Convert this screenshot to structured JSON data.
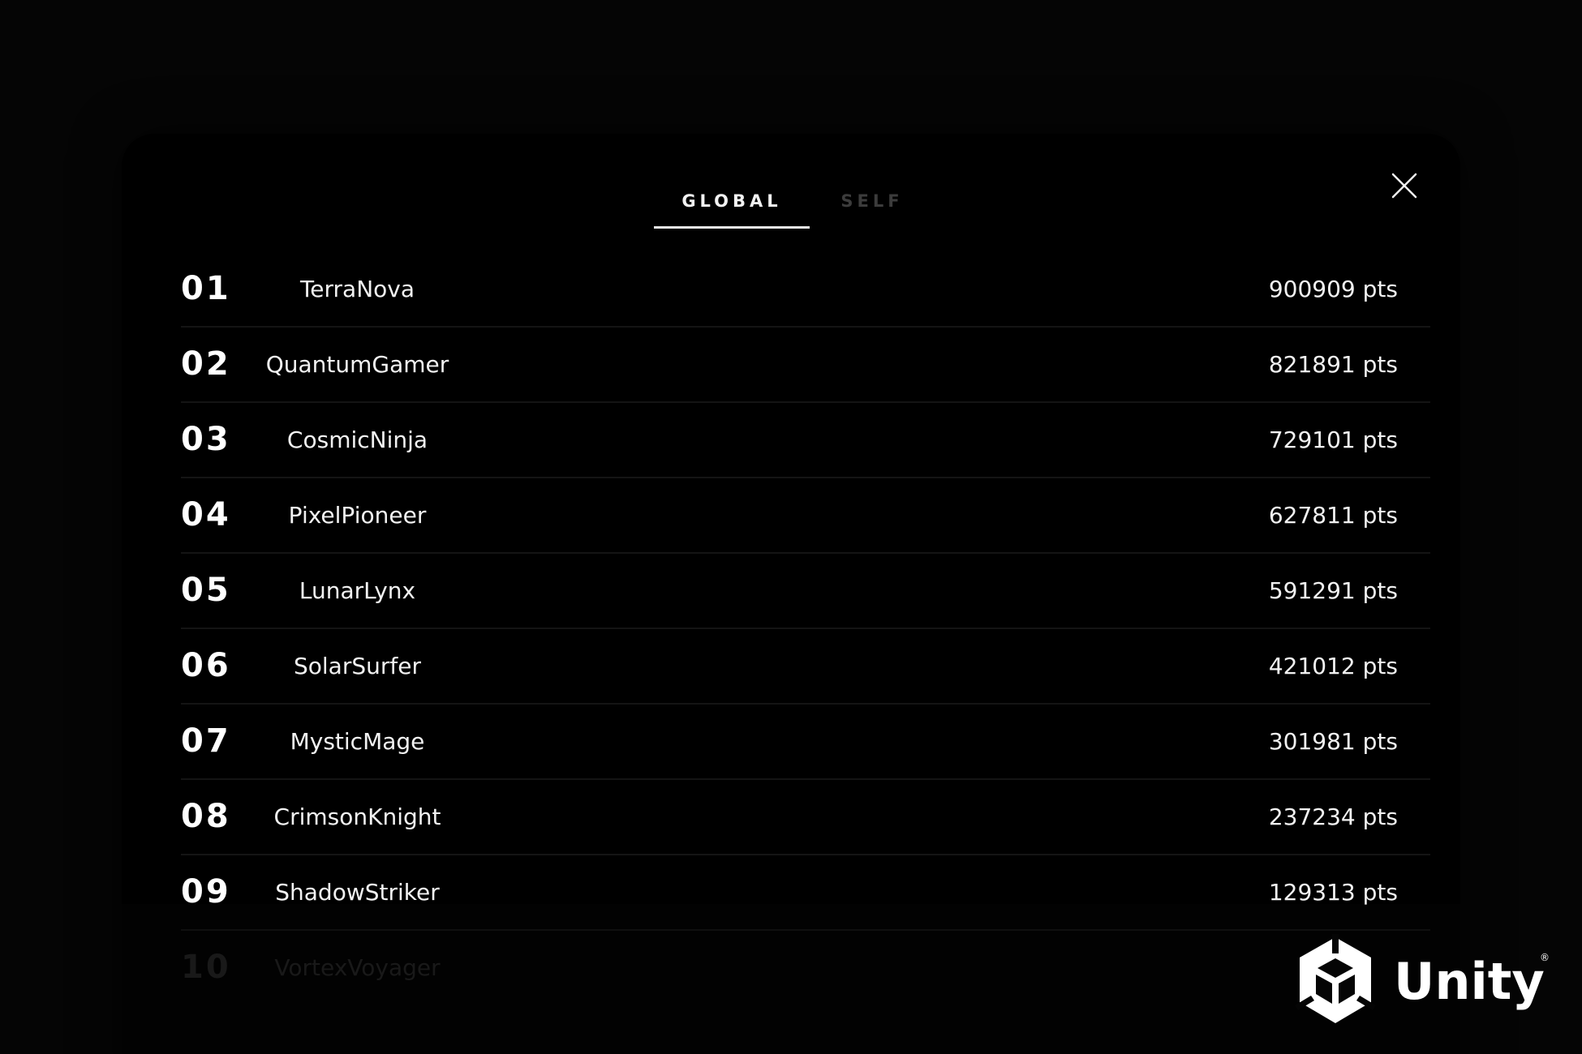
{
  "tabs": {
    "global_label": "GLOBAL",
    "self_label": "SELF",
    "active": "GLOBAL"
  },
  "close_icon": "close-icon",
  "leaderboard": [
    {
      "rank": "01",
      "name": "TerraNova",
      "score": "900909 pts"
    },
    {
      "rank": "02",
      "name": "QuantumGamer",
      "score": "821891 pts"
    },
    {
      "rank": "03",
      "name": "CosmicNinja",
      "score": "729101 pts"
    },
    {
      "rank": "04",
      "name": "PixelPioneer",
      "score": "627811 pts"
    },
    {
      "rank": "05",
      "name": "LunarLynx",
      "score": "591291 pts"
    },
    {
      "rank": "06",
      "name": "SolarSurfer",
      "score": "421012 pts"
    },
    {
      "rank": "07",
      "name": "MysticMage",
      "score": "301981 pts"
    },
    {
      "rank": "08",
      "name": "CrimsonKnight",
      "score": "237234 pts"
    },
    {
      "rank": "09",
      "name": "ShadowStriker",
      "score": "129313 pts"
    },
    {
      "rank": "10",
      "name": "VortexVoyager",
      "score": ""
    }
  ],
  "watermark": {
    "brand": "Unity",
    "registered_mark": "®",
    "icon": "unity-cube-icon"
  },
  "colors": {
    "background": "#050505",
    "panel": "#000000",
    "text": "#f2f2f2",
    "inactive_tab": "#3c3c3c",
    "divider": "#141414"
  }
}
